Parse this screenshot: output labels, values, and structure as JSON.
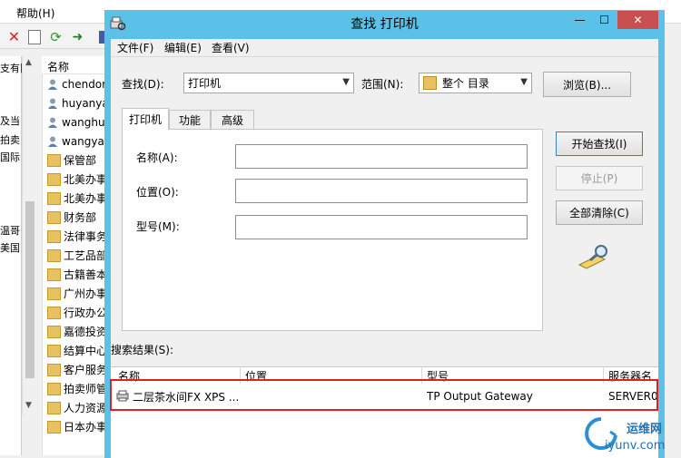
{
  "background_window": {
    "menu": {
      "help": "帮助(H)"
    },
    "tree_labels": [
      "支有限",
      "及当",
      "拍卖",
      "国际",
      "温哥",
      "美国"
    ],
    "list_header": "名称",
    "list_items": [
      {
        "icon": "user-icon",
        "label": "chendor"
      },
      {
        "icon": "user-icon",
        "label": "huyanya"
      },
      {
        "icon": "user-icon",
        "label": "wanghu"
      },
      {
        "icon": "user-icon",
        "label": "wangyar"
      },
      {
        "icon": "folder-icon",
        "label": "保管部"
      },
      {
        "icon": "folder-icon",
        "label": "北美办事"
      },
      {
        "icon": "folder-icon",
        "label": "北美办事"
      },
      {
        "icon": "folder-icon",
        "label": "财务部"
      },
      {
        "icon": "folder-icon",
        "label": "法律事务"
      },
      {
        "icon": "folder-icon",
        "label": "工艺品部"
      },
      {
        "icon": "folder-icon",
        "label": "古籍善本"
      },
      {
        "icon": "folder-icon",
        "label": "广州办事"
      },
      {
        "icon": "folder-icon",
        "label": "行政办公"
      },
      {
        "icon": "folder-icon",
        "label": "嘉德投资"
      },
      {
        "icon": "folder-icon",
        "label": "结算中心"
      },
      {
        "icon": "folder-icon",
        "label": "客户服务"
      },
      {
        "icon": "folder-icon",
        "label": "拍卖师管"
      },
      {
        "icon": "folder-icon",
        "label": "人力资源"
      },
      {
        "icon": "folder-icon",
        "label": "日本办事"
      }
    ]
  },
  "dialog": {
    "title": "查找 打印机",
    "window_buttons": {
      "minimize": "—",
      "maximize": "☐",
      "close": "✕"
    },
    "menu": [
      "文件(F)",
      "编辑(E)",
      "查看(V)"
    ],
    "find_label": "查找(D):",
    "find_value": "打印机",
    "scope_label": "范围(N):",
    "scope_value": "整个 目录",
    "browse_button": "浏览(B)...",
    "tabs": [
      "打印机",
      "功能",
      "高级"
    ],
    "fields": [
      {
        "label": "名称(A):",
        "value": ""
      },
      {
        "label": "位置(O):",
        "value": ""
      },
      {
        "label": "型号(M):",
        "value": ""
      }
    ],
    "buttons": {
      "start": "开始查找(I)",
      "stop": "停止(P)",
      "clear": "全部清除(C)"
    },
    "results_label": "搜索结果(S):",
    "results_columns": [
      "名称",
      "位置",
      "型号",
      "服务器名"
    ],
    "results_rows": [
      {
        "name": "二层茶水间FX XPS ...",
        "location": "",
        "model": "TP Output Gateway",
        "server": "SERVER0"
      }
    ]
  },
  "watermark": {
    "brand": "运维网",
    "url": "iyunv.com"
  },
  "colors": {
    "title_bar": "#5cc1e8",
    "highlight_box": "#dd2222"
  }
}
